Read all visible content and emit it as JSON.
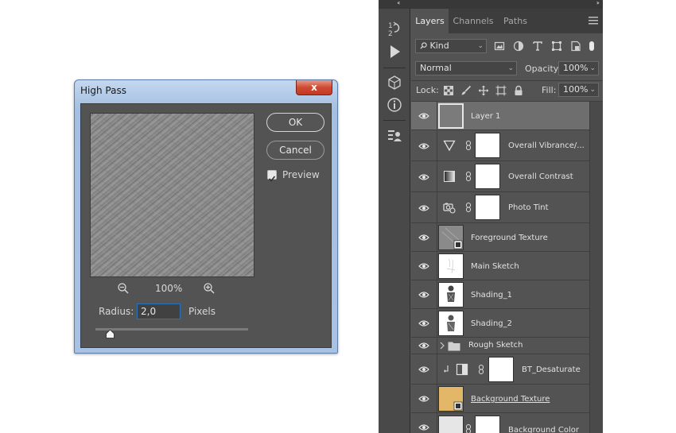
{
  "dialog": {
    "title": "High Pass",
    "close_label": "x",
    "ok_label": "OK",
    "cancel_label": "Cancel",
    "preview_label": "Preview",
    "preview_checked": true,
    "zoom_value": "100%",
    "radius_label": "Radius:",
    "radius_value": "2,0",
    "radius_unit": "Pixels",
    "slider_position_fraction": 0.1
  },
  "photoshop": {
    "collapse_left": "‹‹",
    "collapse_right": "››",
    "tabs": [
      {
        "label": "Layers",
        "active": true
      },
      {
        "label": "Channels",
        "active": false
      },
      {
        "label": "Paths",
        "active": false
      }
    ],
    "filter_kind": "Kind",
    "blend_mode": "Normal",
    "opacity_label": "Opacity:",
    "opacity_value": "100%",
    "lock_label": "Lock:",
    "fill_label": "Fill:",
    "fill_value": "100%",
    "layers": [
      {
        "name": "Layer 1",
        "type": "pixel",
        "selected": true
      },
      {
        "name": "Overall Vibrance/...",
        "type": "adjustment",
        "icon": "vibrance-icon"
      },
      {
        "name": "Overall Contrast",
        "type": "adjustment",
        "icon": "levels-icon"
      },
      {
        "name": "Photo Tint",
        "type": "adjustment",
        "icon": "photo-filter-icon"
      },
      {
        "name": "Foreground Texture",
        "type": "smart"
      },
      {
        "name": "Main Sketch",
        "type": "pixel"
      },
      {
        "name": "Shading_1",
        "type": "pixel"
      },
      {
        "name": "Shading_2",
        "type": "pixel"
      },
      {
        "name": "Rough Sketch",
        "type": "group"
      },
      {
        "name": "BT_Desaturate",
        "type": "adjustment",
        "icon": "black-white-icon",
        "clipped": true
      },
      {
        "name": "Background Texture",
        "type": "smart",
        "color": "#e2b768"
      },
      {
        "name": "Background Color",
        "type": "fill"
      }
    ]
  }
}
